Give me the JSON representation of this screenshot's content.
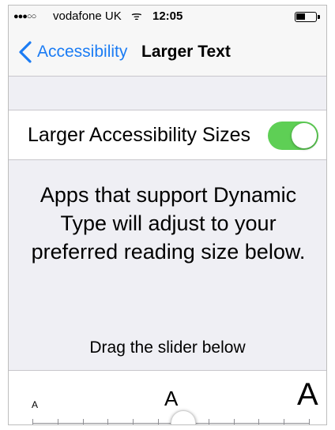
{
  "status_bar": {
    "signal": "●●●○○",
    "carrier": "vodafone UK",
    "wifi_glyph": "ᯤ",
    "time": "12:05"
  },
  "nav": {
    "back_label": "Accessibility",
    "title": "Larger Text"
  },
  "toggle": {
    "label": "Larger Accessibility Sizes",
    "on": true,
    "on_color": "#5ecf55"
  },
  "description": "Apps that support Dynamic Type will adjust to your preferred reading size below.",
  "hint": "Drag the slider below",
  "slider": {
    "min_label": "A",
    "mid_label": "A",
    "max_label": "A",
    "steps": 12,
    "value_step": 6
  },
  "colors": {
    "accent": "#1b7cf4",
    "background": "#efeff4"
  }
}
